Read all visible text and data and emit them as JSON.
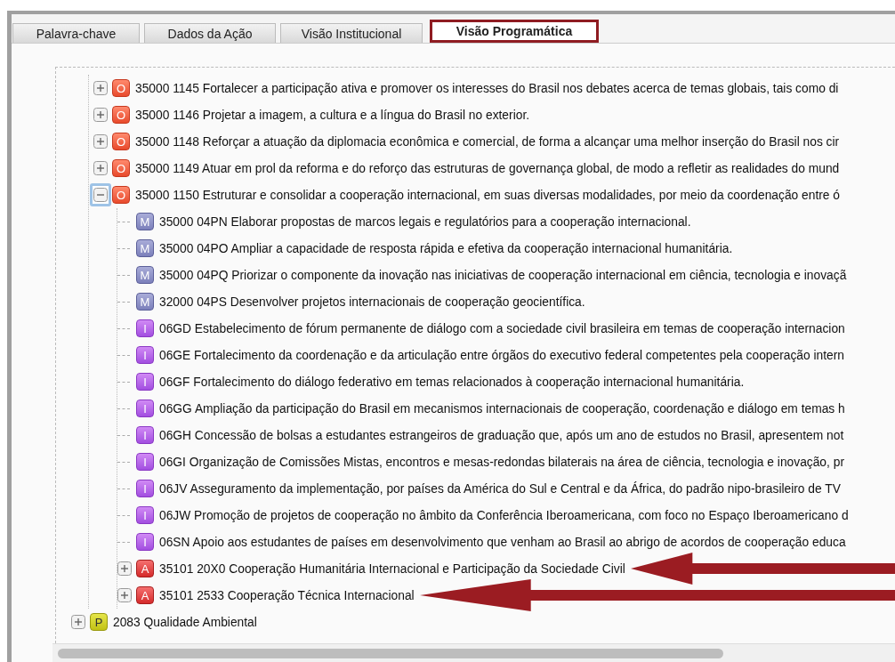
{
  "tabs": [
    {
      "label": "Palavra-chave",
      "selected": false
    },
    {
      "label": "Dados da Ação",
      "selected": false
    },
    {
      "label": "Visão Institucional",
      "selected": false
    },
    {
      "label": "Visão Programática",
      "selected": true
    }
  ],
  "tree": {
    "objectives": [
      {
        "kind": "O",
        "badge": "O",
        "text": "35000 1145 Fortalecer a participação ativa e promover os interesses do Brasil nos debates acerca de temas globais, tais como di",
        "expanded": false,
        "focused": false,
        "arrow": false
      },
      {
        "kind": "O",
        "badge": "O",
        "text": "35000 1146 Projetar a imagem, a cultura e a língua do Brasil no exterior.",
        "expanded": false,
        "focused": false,
        "arrow": false
      },
      {
        "kind": "O",
        "badge": "O",
        "text": "35000 1148 Reforçar a atuação da diplomacia econômica e comercial, de forma a alcançar uma melhor inserção do Brasil nos cir",
        "expanded": false,
        "focused": false,
        "arrow": false
      },
      {
        "kind": "O",
        "badge": "O",
        "text": "35000 1149 Atuar em prol da reforma e do reforço das estruturas de governança global, de modo a refletir as realidades do mund",
        "expanded": false,
        "focused": false,
        "arrow": false
      },
      {
        "kind": "O",
        "badge": "O",
        "text": "35000 1150 Estruturar e consolidar a cooperação internacional, em suas diversas modalidades, por meio da coordenação entre ó",
        "expanded": true,
        "focused": true,
        "arrow": false,
        "children": [
          {
            "kind": "M",
            "badge": "M",
            "text": "35000 04PN Elaborar propostas de marcos legais e regulatórios para a cooperação internacional.",
            "arrow": false
          },
          {
            "kind": "M",
            "badge": "M",
            "text": "35000 04PO Ampliar a capacidade de resposta rápida e efetiva da cooperação internacional humanitária.",
            "arrow": false
          },
          {
            "kind": "M",
            "badge": "M",
            "text": "35000 04PQ Priorizar o componente da inovação nas iniciativas de cooperação internacional em ciência, tecnologia e inovaçã",
            "arrow": false
          },
          {
            "kind": "M",
            "badge": "M",
            "text": "32000 04PS Desenvolver projetos internacionais de cooperação geocientífica.",
            "arrow": false
          },
          {
            "kind": "I",
            "badge": "I",
            "text": "06GD Estabelecimento de fórum permanente de diálogo com a sociedade civil brasileira em temas de cooperação internacion",
            "arrow": false
          },
          {
            "kind": "I",
            "badge": "I",
            "text": "06GE Fortalecimento da coordenação e da articulação entre órgãos do executivo federal competentes pela cooperação intern",
            "arrow": false
          },
          {
            "kind": "I",
            "badge": "I",
            "text": "06GF Fortalecimento do diálogo federativo em temas relacionados à cooperação internacional humanitária.",
            "arrow": false
          },
          {
            "kind": "I",
            "badge": "I",
            "text": "06GG Ampliação da participação do Brasil em mecanismos internacionais de cooperação, coordenação e diálogo em temas h",
            "arrow": false
          },
          {
            "kind": "I",
            "badge": "I",
            "text": "06GH Concessão de bolsas a estudantes estrangeiros de graduação que, após um ano de estudos no Brasil, apresentem not",
            "arrow": false
          },
          {
            "kind": "I",
            "badge": "I",
            "text": "06GI Organização de Comissões Mistas, encontros e mesas-redondas bilaterais na área de ciência, tecnologia e inovação, pr",
            "arrow": false
          },
          {
            "kind": "I",
            "badge": "I",
            "text": "06JV Asseguramento da implementação, por países da América do Sul e Central e da África, do padrão nipo-brasileiro de TV",
            "arrow": false
          },
          {
            "kind": "I",
            "badge": "I",
            "text": "06JW Promoção de projetos de cooperação no âmbito da Conferência Iberoamericana, com foco no Espaço Iberoamericano d",
            "arrow": false
          },
          {
            "kind": "I",
            "badge": "I",
            "text": "06SN Apoio aos estudantes de países em desenvolvimento que venham ao Brasil ao abrigo de acordos de cooperação educa",
            "arrow": false
          },
          {
            "kind": "A",
            "badge": "A",
            "text": "35101 20X0 Cooperação Humanitária Internacional e Participação da Sociedade Civil",
            "expanded": false,
            "focused": false,
            "arrow": true
          },
          {
            "kind": "A",
            "badge": "A",
            "text": "35101 2533 Cooperação Técnica Internacional",
            "expanded": false,
            "focused": false,
            "arrow": true
          }
        ]
      }
    ],
    "programs": [
      {
        "kind": "P",
        "badge": "P",
        "text": "2083 Qualidade Ambiental",
        "expanded": false,
        "focused": false,
        "arrow": false
      }
    ]
  }
}
